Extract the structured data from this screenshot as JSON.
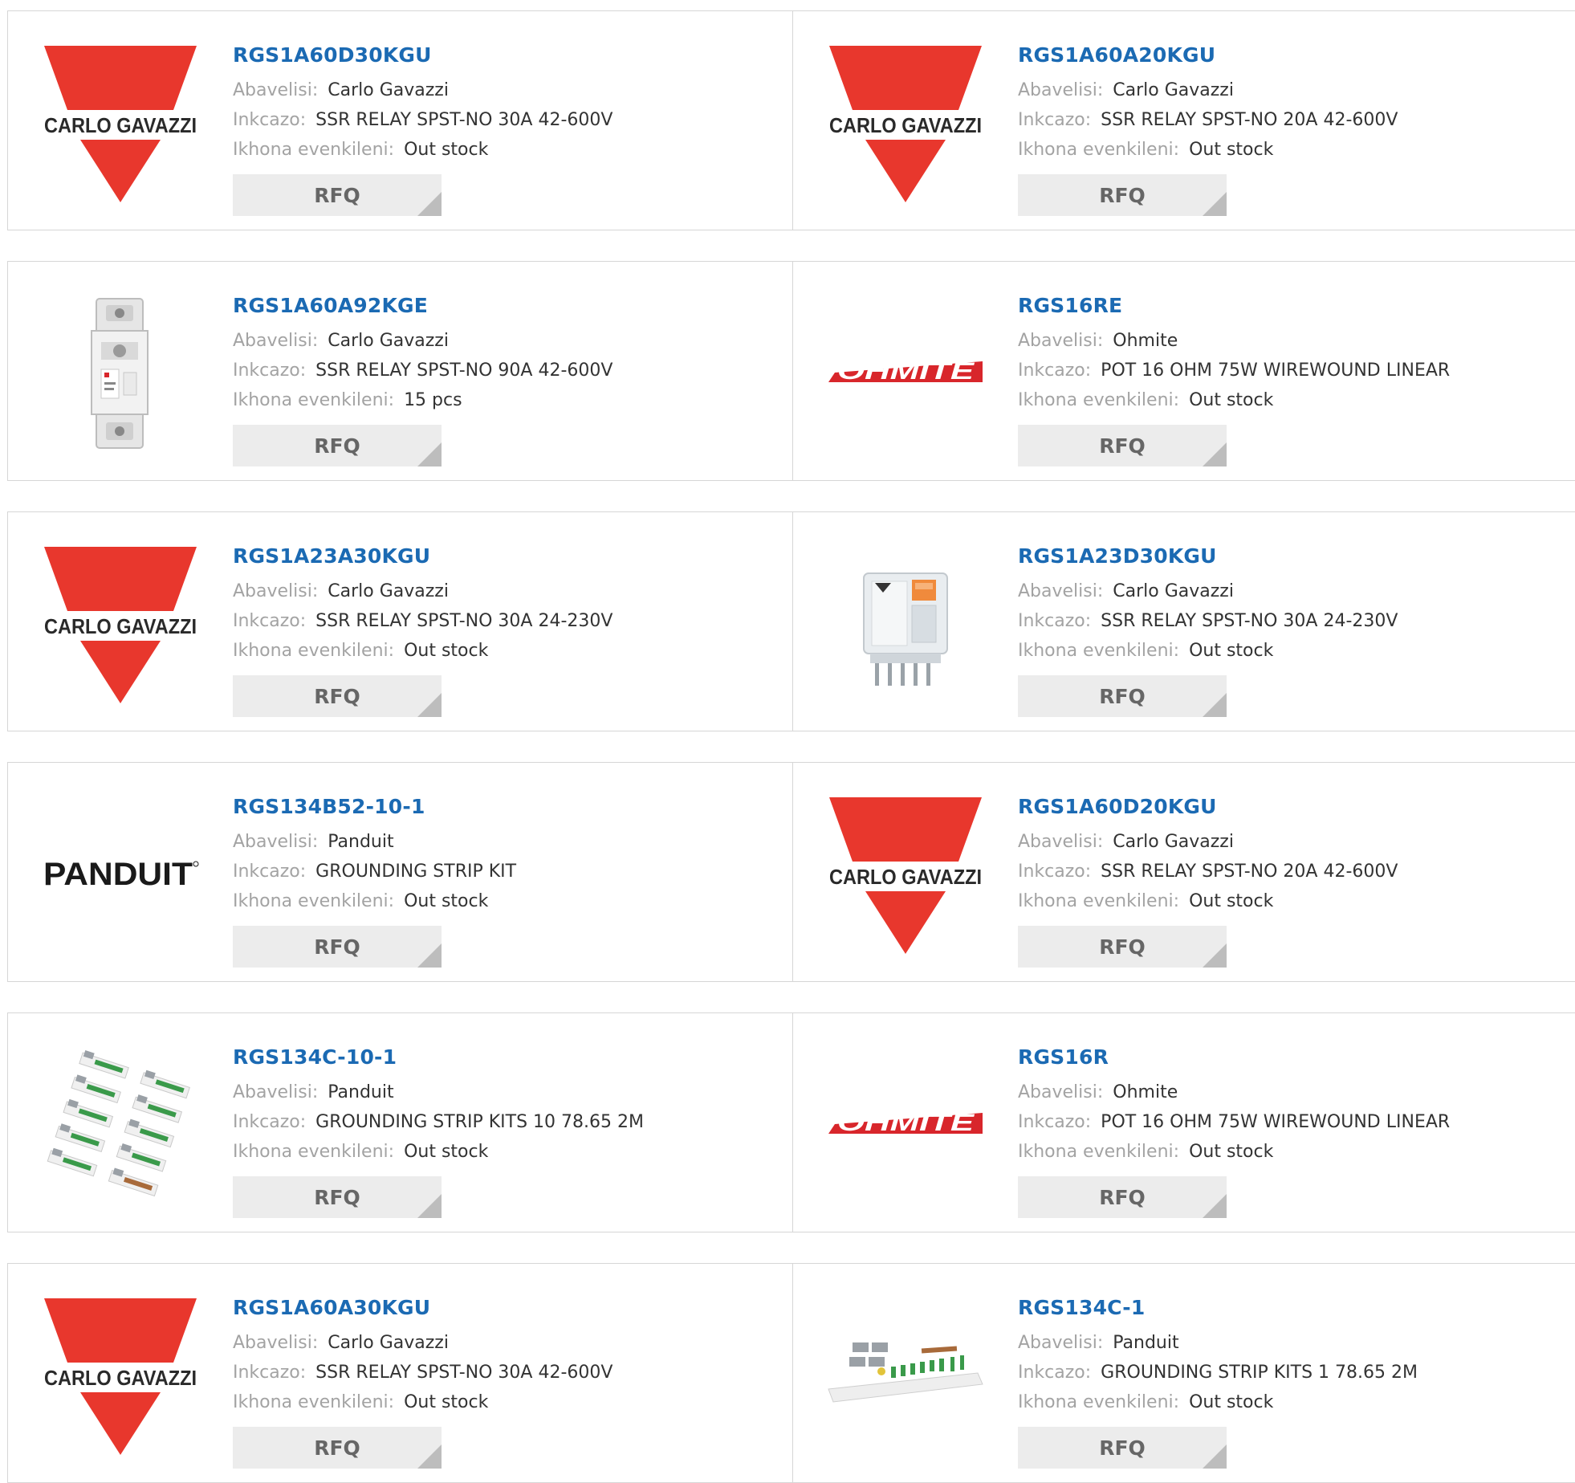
{
  "labels": {
    "manufacturer": "Abavelisi:",
    "description": "Inkcazo:",
    "stock": "Ikhona evenkileni:",
    "rfq": "RFQ"
  },
  "colors": {
    "link": "#1b6ab3",
    "label": "#a3a3a3",
    "carlo_gavazzi_red": "#e8372d",
    "ohmite_red": "#d8262b",
    "button_bg": "#ececec"
  },
  "products": [
    {
      "part": "RGS1A60D30KGU",
      "manufacturer": "Carlo Gavazzi",
      "description": "SSR RELAY SPST-NO 30A 42-600V",
      "stock": "Out stock",
      "image": "carlo-gavazzi-logo"
    },
    {
      "part": "RGS1A60A20KGU",
      "manufacturer": "Carlo Gavazzi",
      "description": "SSR RELAY SPST-NO 20A 42-600V",
      "stock": "Out stock",
      "image": "carlo-gavazzi-logo"
    },
    {
      "part": "RGS1A60A92KGE",
      "manufacturer": "Carlo Gavazzi",
      "description": "SSR RELAY SPST-NO 90A 42-600V",
      "stock": "15 pcs",
      "image": "din-rail-relay-photo"
    },
    {
      "part": "RGS16RE",
      "manufacturer": "Ohmite",
      "description": "POT 16 OHM 75W WIREWOUND LINEAR",
      "stock": "Out stock",
      "image": "ohmite-logo",
      "logo_text": "OHMITE"
    },
    {
      "part": "RGS1A23A30KGU",
      "manufacturer": "Carlo Gavazzi",
      "description": "SSR RELAY SPST-NO 30A 24-230V",
      "stock": "Out stock",
      "image": "carlo-gavazzi-logo"
    },
    {
      "part": "RGS1A23D30KGU",
      "manufacturer": "Carlo Gavazzi",
      "description": "SSR RELAY SPST-NO 30A 24-230V",
      "stock": "Out stock",
      "image": "plug-in-relay-photo"
    },
    {
      "part": "RGS134B52-10-1",
      "manufacturer": "Panduit",
      "description": "GROUNDING STRIP KIT",
      "stock": "Out stock",
      "image": "panduit-logo",
      "logo_text": "PANDUIT"
    },
    {
      "part": "RGS1A60D20KGU",
      "manufacturer": "Carlo Gavazzi",
      "description": "SSR RELAY SPST-NO 20A 42-600V",
      "stock": "Out stock",
      "image": "carlo-gavazzi-logo"
    },
    {
      "part": "RGS134C-10-1",
      "manufacturer": "Panduit",
      "description": "GROUNDING STRIP KITS 10 78.65 2M",
      "stock": "Out stock",
      "image": "grounding-strip-kits-photo"
    },
    {
      "part": "RGS16R",
      "manufacturer": "Ohmite",
      "description": "POT 16 OHM 75W WIREWOUND LINEAR",
      "stock": "Out stock",
      "image": "ohmite-logo",
      "logo_text": "OHMITE"
    },
    {
      "part": "RGS1A60A30KGU",
      "manufacturer": "Carlo Gavazzi",
      "description": "SSR RELAY SPST-NO 30A 42-600V",
      "stock": "Out stock",
      "image": "carlo-gavazzi-logo"
    },
    {
      "part": "RGS134C-1",
      "manufacturer": "Panduit",
      "description": "GROUNDING STRIP KITS 1 78.65 2M",
      "stock": "Out stock",
      "image": "grounding-strip-kit-photo"
    }
  ]
}
